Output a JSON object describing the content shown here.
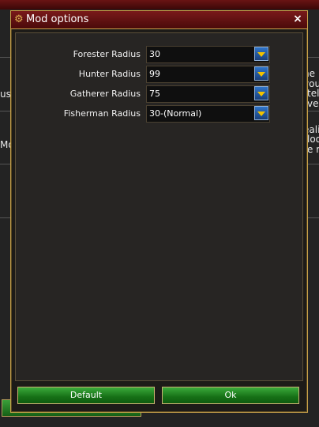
{
  "background": {
    "left_snippets": [
      "us",
      "Mo"
    ],
    "right_snippets": [
      "ne",
      "you",
      "tel",
      "ve t",
      "ealis",
      "look",
      "e m"
    ]
  },
  "dialog": {
    "title": "Mod options",
    "close_label": "×",
    "title_icon": "gear-icon",
    "rows": [
      {
        "label": "Forester Radius",
        "value": "30"
      },
      {
        "label": "Hunter Radius",
        "value": "99"
      },
      {
        "label": "Gatherer Radius",
        "value": "75"
      },
      {
        "label": "Fisherman Radius",
        "value": "30-(Normal)"
      }
    ],
    "buttons": {
      "default_label": "Default",
      "ok_label": "Ok"
    }
  },
  "colors": {
    "accent_gold": "#c9a24a",
    "title_red": "#7a1a1a",
    "button_green": "#167016",
    "dropdown_blue": "#2f74c8"
  }
}
